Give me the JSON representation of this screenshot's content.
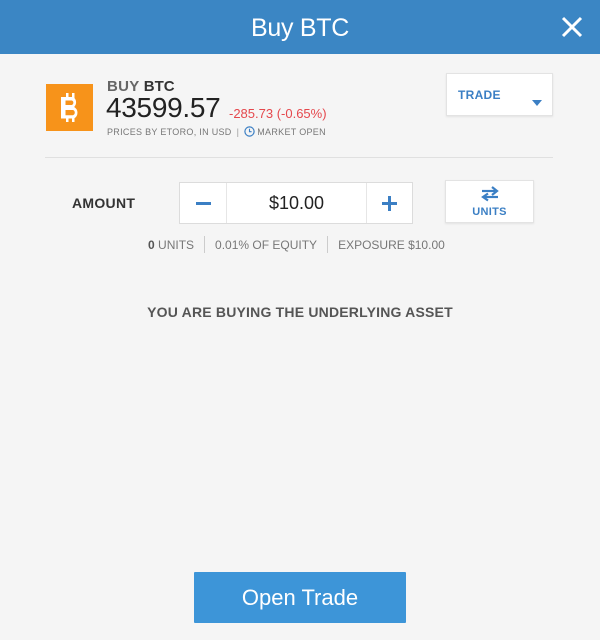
{
  "header": {
    "title": "Buy BTC"
  },
  "instrument": {
    "action": "BUY",
    "symbol": "BTC",
    "price": "43599.57",
    "change": "-285.73 (-0.65%)",
    "prices_by": "PRICES BY ETORO, IN USD",
    "market_status": "MARKET OPEN",
    "logo_color": "#f7931a"
  },
  "order_type": {
    "selected": "TRADE"
  },
  "amount": {
    "label": "AMOUNT",
    "value": "$10.00",
    "toggle_label": "UNITS"
  },
  "details": {
    "units_count": "0",
    "units_label": "UNITS",
    "equity": "0.01% OF EQUITY",
    "exposure": "EXPOSURE $10.00"
  },
  "notice": "YOU ARE BUYING THE UNDERLYING ASSET",
  "submit": {
    "label": "Open Trade"
  },
  "colors": {
    "header": "#3b86c4",
    "accent": "#3b7fc4",
    "button": "#3d95d8",
    "negative": "#e5484d"
  }
}
